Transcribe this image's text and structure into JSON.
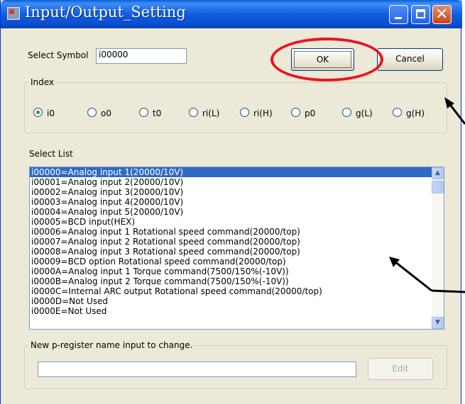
{
  "window": {
    "title": "Input/Output_Setting"
  },
  "symbol": {
    "label": "Select Symbol",
    "value": "i00000"
  },
  "buttons": {
    "ok": "OK",
    "cancel": "Cancel",
    "edit": "Edit"
  },
  "index": {
    "title": "Index",
    "options": [
      {
        "label": "i0",
        "selected": true
      },
      {
        "label": "o0",
        "selected": false
      },
      {
        "label": "t0",
        "selected": false
      },
      {
        "label": "ri(L)",
        "selected": false
      },
      {
        "label": "ri(H)",
        "selected": false
      },
      {
        "label": "p0",
        "selected": false
      },
      {
        "label": "g(L)",
        "selected": false
      },
      {
        "label": "g(H)",
        "selected": false
      }
    ]
  },
  "select_list": {
    "label": "Select List",
    "items": [
      "i00000=Analog input 1(20000/10V)",
      "i00001=Analog input 2(20000/10V)",
      "i00002=Analog input 3(20000/10V)",
      "i00003=Analog input 4(20000/10V)",
      "i00004=Analog input 5(20000/10V)",
      "i00005=BCD input(HEX)",
      "i00006=Analog input 1 Rotational speed command(20000/top)",
      "i00007=Analog input 2 Rotational speed command(20000/top)",
      "i00008=Analog input 3 Rotational speed command(20000/top)",
      "i00009=BCD option Rotational speed command(20000/top)",
      "i0000A=Analog input 1 Torque command(7500/150%(-10V))",
      "i0000B=Analog input 2 Torque command(7500/150%(-10V))",
      "i0000C=Internal ARC output Rotational speed command(20000/top)",
      "i0000D=Not Used",
      "i0000E=Not Used"
    ],
    "selected_index": 0
  },
  "new_name": {
    "title": "New p-register name input to change.",
    "value": ""
  },
  "colors": {
    "highlight_ellipse": "#e8141e",
    "selection": "#316ac5",
    "titlebar": "#0a5fd8"
  }
}
